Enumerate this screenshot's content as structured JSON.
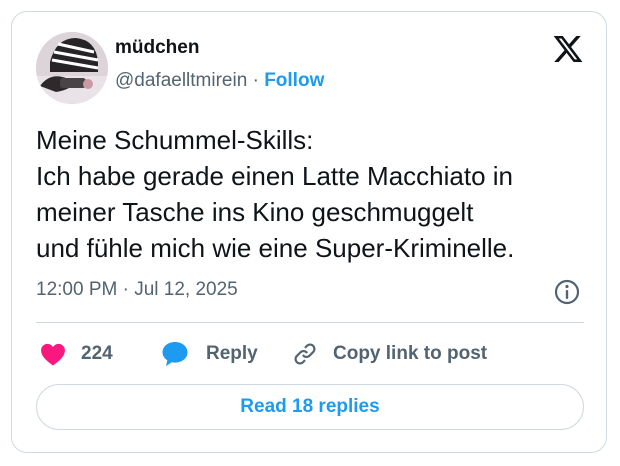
{
  "user": {
    "display_name": "müdchen",
    "handle": "@dafaelltmirein",
    "separator": "·",
    "follow_label": "Follow"
  },
  "tweet": {
    "lines": [
      "Meine Schummel-Skills:",
      "Ich habe gerade einen Latte Macchiato in",
      "meiner Tasche ins Kino geschmuggelt",
      "und fühle mich wie eine Super-Kriminelle."
    ],
    "timestamp": "12:00 PM · Jul 12, 2025"
  },
  "actions": {
    "like_count": "224",
    "reply_label": "Reply",
    "copy_label": "Copy link to post"
  },
  "footer": {
    "read_replies_label": "Read 18 replies"
  },
  "colors": {
    "accent": "#1d9bf0",
    "like": "#f91880",
    "secondary_text": "#536471",
    "border": "#cfd9de"
  },
  "icons": {
    "brand": "x-logo-icon",
    "info": "info-icon",
    "like": "heart-icon",
    "reply": "speech-bubble-icon",
    "copy": "link-icon"
  }
}
